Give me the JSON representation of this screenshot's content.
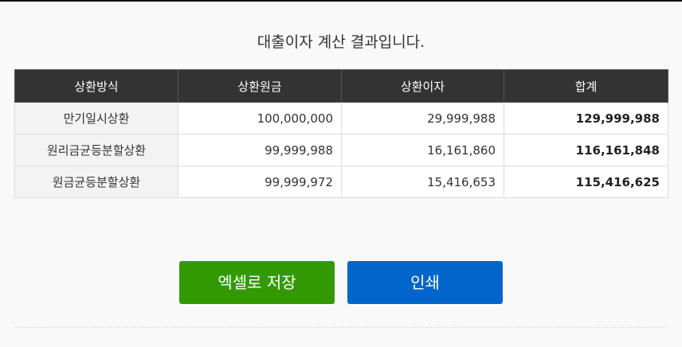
{
  "title": "대출이자 계산 결과입니다.",
  "table": {
    "headers": [
      "상환방식",
      "상환원금",
      "상환이자",
      "합계"
    ],
    "rows": [
      {
        "method": "만기일시상환",
        "principal": "100,000,000",
        "interest": "29,999,988",
        "total": "129,999,988"
      },
      {
        "method": "원리금균등분할상환",
        "principal": "99,999,988",
        "interest": "16,161,860",
        "total": "116,161,848"
      },
      {
        "method": "원금균등분할상환",
        "principal": "99,999,972",
        "interest": "15,416,653",
        "total": "115,416,625"
      }
    ]
  },
  "buttons": {
    "excel_label": "엑셀로 저장",
    "print_label": "인쇄"
  },
  "colors": {
    "header_bg": "#333333",
    "excel_button": "#339900",
    "print_button": "#0066cc"
  }
}
